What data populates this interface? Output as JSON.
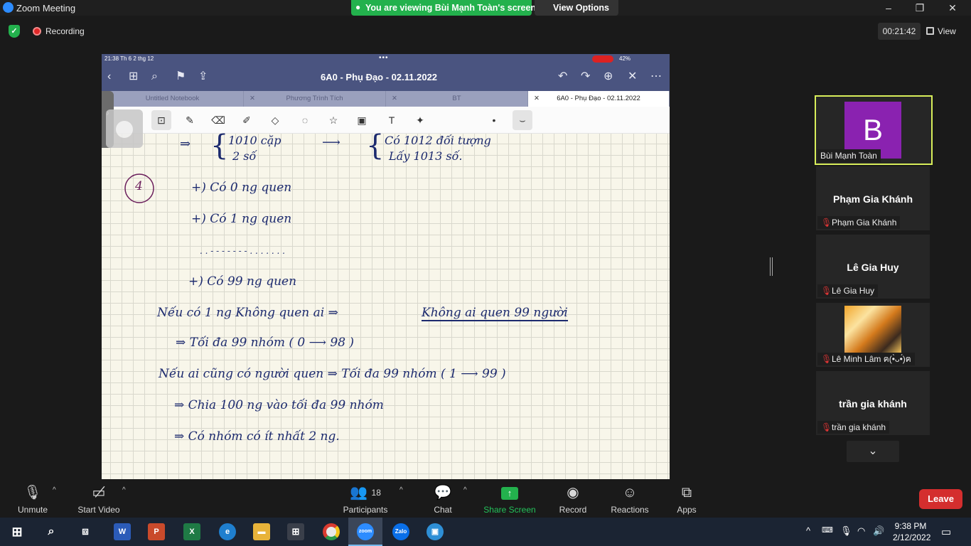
{
  "window": {
    "title": "Zoom Meeting"
  },
  "banner": {
    "viewing_text": "You are viewing Bùi Mạnh Toàn's screen",
    "view_options": "View Options"
  },
  "topbar": {
    "recording": "Recording",
    "timer": "00:21:42",
    "view": "View"
  },
  "shared_screen": {
    "ios_status": {
      "left": "21:38   Th 6 2 thg 12",
      "right": "42%"
    },
    "notebook_title": "6A0 - Phụ Đạo - 02.11.2022",
    "tabs": [
      "Untitled Notebook",
      "Phương Trình Tích",
      "BT",
      "6A0 - Phụ Đạo - 02.11.2022"
    ],
    "handwriting": {
      "l1a": "⇒",
      "l1b": "1010  cặp",
      "l1c": "2  số",
      "l1d": "Có  1012  đối  tượng",
      "l1e": "Lấy  1013  số.",
      "circle_num": "4",
      "l2": "+)   Có  0  ng  quen",
      "l3": "+)   Có  1  ng  quen",
      "l4": ". . - - - - - - - . . . . . . .",
      "l5": "+)   Có  99  ng  quen",
      "l6a": "Nếu  có  1  ng  Không  quen  ai  ⇒",
      "l6b": "Không  ai  quen  99  người",
      "l7": "⇒   Tối  đa  99  nhóm  ( 0 ⟶ 98 )",
      "l8": "Nếu  ai  cũng  có  người  quen  ⇒  Tối  đa  99  nhóm  ( 1 ⟶ 99 )",
      "l9": "⇒   Chia  100  ng  vào  tối  đa  99  nhóm",
      "l10": "⇒   Có  nhóm  có  ít  nhất  2  ng."
    }
  },
  "participants": [
    {
      "tile_name": "",
      "avatar_letter": "B",
      "label": "Bùi Mạnh Toàn"
    },
    {
      "tile_name": "Phạm Gia Khánh",
      "label": "Phạm Gia Khánh"
    },
    {
      "tile_name": "Lê Gia Huy",
      "label": "Lê Gia Huy"
    },
    {
      "tile_name": "",
      "label": "Lê Minh Lâm ฅ(•̀ᴗ•́)ฅ"
    },
    {
      "tile_name": "trần gia khánh",
      "label": "trần gia khánh"
    }
  ],
  "controls": {
    "unmute": "Unmute",
    "start_video": "Start Video",
    "participants_count": "18",
    "participants": "Participants",
    "chat": "Chat",
    "share_screen": "Share Screen",
    "record": "Record",
    "reactions": "Reactions",
    "apps": "Apps",
    "leave": "Leave"
  },
  "taskbar": {
    "time": "9:38 PM",
    "date": "2/12/2022"
  },
  "colors": {
    "banner_green": "#23b14d",
    "leave_red": "#d42e2e",
    "active_speaker": "#d8ee5a",
    "notebook_header": "#4a5480",
    "ink": "#1c2a6e"
  }
}
